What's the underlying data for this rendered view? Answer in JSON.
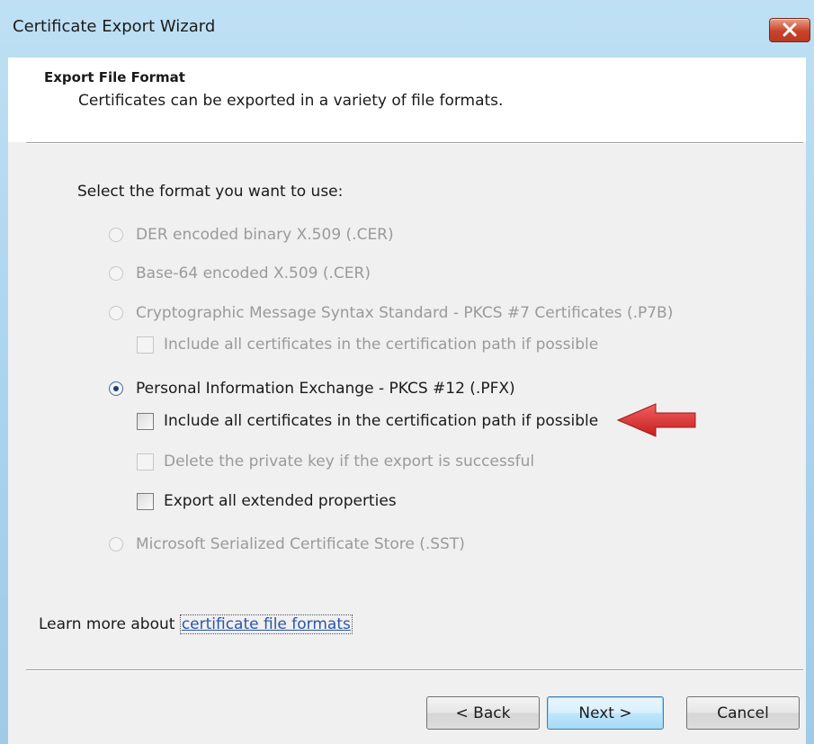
{
  "window": {
    "title": "Certificate Export Wizard"
  },
  "header": {
    "heading": "Export File Format",
    "description": "Certificates can be exported in a variety of file formats."
  },
  "form": {
    "prompt": "Select the format you want to use:",
    "options": [
      {
        "label": "DER encoded binary X.509 (.CER)",
        "selected": false,
        "enabled": false
      },
      {
        "label": "Base-64 encoded X.509 (.CER)",
        "selected": false,
        "enabled": false
      },
      {
        "label": "Cryptographic Message Syntax Standard - PKCS #7 Certificates (.P7B)",
        "selected": false,
        "enabled": false
      },
      {
        "label": "Personal Information Exchange - PKCS #12 (.PFX)",
        "selected": true,
        "enabled": true
      },
      {
        "label": "Microsoft Serialized Certificate Store (.SST)",
        "selected": false,
        "enabled": false
      }
    ],
    "p7b_checkboxes": [
      {
        "label": "Include all certificates in the certification path if possible",
        "checked": false,
        "enabled": false
      }
    ],
    "pfx_checkboxes": [
      {
        "label": "Include all certificates in the certification path if possible",
        "checked": false,
        "enabled": true
      },
      {
        "label": "Delete the private key if the export is successful",
        "checked": false,
        "enabled": false
      },
      {
        "label": "Export all extended properties",
        "checked": false,
        "enabled": true
      }
    ]
  },
  "learn_more": {
    "prefix": "Learn more about ",
    "link": "certificate file formats"
  },
  "buttons": {
    "back": "< Back",
    "next": "Next >",
    "cancel": "Cancel"
  },
  "annotation": {
    "arrow_color": "#d92b2b"
  }
}
